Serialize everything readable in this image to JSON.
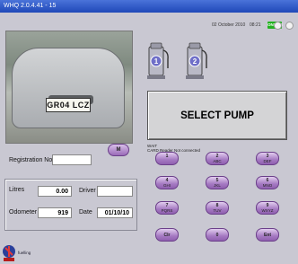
{
  "window": {
    "title": "WHQ 2.0.4.41 - 15"
  },
  "status": {
    "date": "02 October 2010",
    "time": "08:21",
    "online_badge": "ONLINE"
  },
  "camera": {
    "plate": "GR04 LCZ"
  },
  "pumps": [
    {
      "number": "1",
      "color": "#6f6fc8"
    },
    {
      "number": "2",
      "color": "#6f6fc8"
    }
  ],
  "display": {
    "message": "SELECT PUMP",
    "status_line1": "WAIT",
    "status_line2": "CARD Reader Not connected"
  },
  "form": {
    "registration_label": "Registration No",
    "registration_value": "",
    "m_button": "M",
    "litres_label": "Litres",
    "litres_value": "0.00",
    "driver_label": "Driver",
    "driver_value": "",
    "odometer_label": "Odometer",
    "odometer_value": "919",
    "date_label": "Date",
    "date_value": "01/10/10"
  },
  "keypad": [
    {
      "num": "1",
      "letters": ""
    },
    {
      "num": "2",
      "letters": "ABC"
    },
    {
      "num": "3",
      "letters": "DEF"
    },
    {
      "num": "4",
      "letters": "GHI"
    },
    {
      "num": "5",
      "letters": "JKL"
    },
    {
      "num": "6",
      "letters": "MNO"
    },
    {
      "num": "7",
      "letters": "PQRS"
    },
    {
      "num": "8",
      "letters": "TUV"
    },
    {
      "num": "9",
      "letters": "WXYZ"
    },
    {
      "num": "Clr",
      "letters": ""
    },
    {
      "num": "0",
      "letters": ""
    },
    {
      "num": "Ent",
      "letters": ""
    }
  ],
  "footer": {
    "logo_text": "fuelling"
  },
  "colors": {
    "accent": "#a57ac2",
    "titlebar": "#2a55c4",
    "online": "#22b21f"
  }
}
